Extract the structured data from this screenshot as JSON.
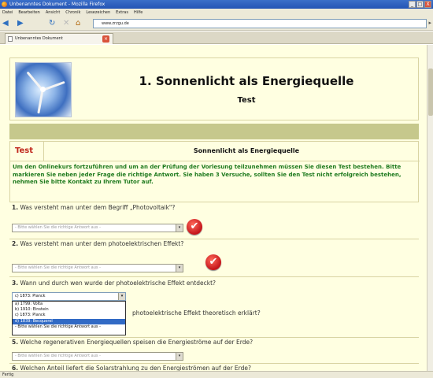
{
  "window": {
    "title": "Unbenanntes Dokument - Mozilla Firefox",
    "btn_min": "_",
    "btn_max": "□",
    "btn_close": "X"
  },
  "menu": [
    "Datei",
    "Bearbeiten",
    "Ansicht",
    "Chronik",
    "Lesezeichen",
    "Extras",
    "Hilfe"
  ],
  "nav": {
    "back": "◀",
    "forward": "▶",
    "reload": "↻",
    "stop": "✕",
    "home": "⌂",
    "url": "www.zrzgu.de",
    "go": "▸"
  },
  "tab": {
    "label": "Unbenanntes Dokument",
    "close": "×"
  },
  "header": {
    "title": "1. Sonnenlicht als Energiequelle",
    "subtitle": "Test"
  },
  "section": {
    "label": "Test",
    "title": "Sonnenlicht als Energiequelle",
    "intro": "Um den Onlinekurs fortzuführen und um an der Prüfung der Vorlesung teilzunehmen müssen Sie diesen Test bestehen. Bitte markieren Sie neben jeder Frage die richtige Antwort. Sie haben 3 Versuche, sollten Sie den Test nicht erfolgreich bestehen, nehmen Sie bitte Kontakt zu Ihrem Tutor auf."
  },
  "questions": [
    {
      "num": "1.",
      "text": "Was versteht man unter dem Begriff „Photovoltaik\"?",
      "select": "- Bitte wählen Sie die richtige Antwort aus -"
    },
    {
      "num": "2.",
      "text": "Was versteht man unter dem photoelektrischen Effekt?",
      "select": "- Bitte wählen Sie die richtige Antwort aus -"
    },
    {
      "num": "3.",
      "text": "Wann und durch wen wurde der photoelektrische Effekt entdeckt?",
      "select": "c) 1873: Planck"
    },
    {
      "num": "",
      "text": "photoelektrische Effekt theoretisch erklärt?"
    },
    {
      "num": "5.",
      "text": "Welche regenerativen Energiequellen speisen die Energieströme auf der Erde?",
      "select": "- Bitte wählen Sie die richtige Antwort aus -"
    },
    {
      "num": "6.",
      "text": "Welchen Anteil liefert die Solarstrahlung zu den Energieströmen auf der Erde?"
    }
  ],
  "dropdown_options": [
    "a) 1799: Volta",
    "b) 1910: Einstein",
    "c) 1873: Planck",
    "d) 1839: Becquerel",
    "- Bitte wählen Sie die richtige Antwort aus -"
  ],
  "check_glyph": "✔",
  "select_arrow": "▾",
  "status": "Fertig"
}
